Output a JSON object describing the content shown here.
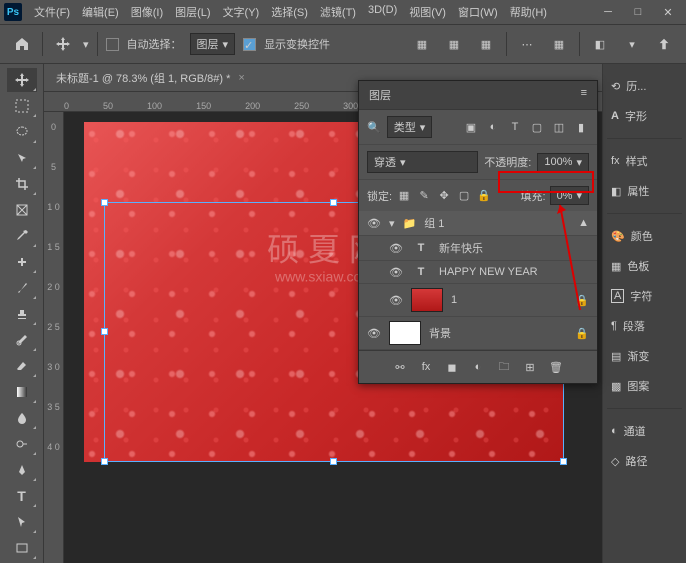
{
  "menu": {
    "file": "文件(F)",
    "edit": "编辑(E)",
    "image": "图像(I)",
    "layer": "图层(L)",
    "type": "文字(Y)",
    "select": "选择(S)",
    "filter": "滤镜(T)",
    "threed": "3D(D)",
    "view": "视图(V)",
    "window": "窗口(W)",
    "help": "帮助(H)"
  },
  "toolbar": {
    "auto_select": "自动选择：",
    "target": "图层",
    "show_transform": "显示变换控件"
  },
  "doc_tab": "未标题-1 @ 78.3% (组 1, RGB/8#) *",
  "rulers_h": [
    "0",
    "50",
    "100",
    "150",
    "200",
    "250",
    "300"
  ],
  "rulers_v": [
    "0",
    "5",
    "1 0",
    "1 5",
    "2 0",
    "2 5",
    "3 0",
    "3 5",
    "4 0"
  ],
  "watermark": {
    "big": "硕 夏 网",
    "small": "www.sxiaw.com"
  },
  "layers": {
    "title": "图层",
    "filter": "类型",
    "blend": "穿透",
    "opacity_label": "不透明度:",
    "opacity": "100%",
    "lock_label": "锁定:",
    "fill_label": "填充:",
    "fill": "0%",
    "items": [
      {
        "name": "组 1",
        "type": "group"
      },
      {
        "name": "新年快乐",
        "type": "text"
      },
      {
        "name": "HAPPY NEW YEAR",
        "type": "text"
      },
      {
        "name": "1",
        "type": "image",
        "thumb": "red",
        "locked": true
      },
      {
        "name": "背景",
        "type": "image",
        "thumb": "white",
        "locked": true
      }
    ]
  },
  "right": {
    "history": "历...",
    "glyphs": "字形",
    "styles": "样式",
    "properties": "属性",
    "color": "颜色",
    "swatches": "色板",
    "character": "字符",
    "paragraph": "段落",
    "gradient": "渐变",
    "pattern": "图案",
    "channels": "通道",
    "paths": "路径"
  }
}
